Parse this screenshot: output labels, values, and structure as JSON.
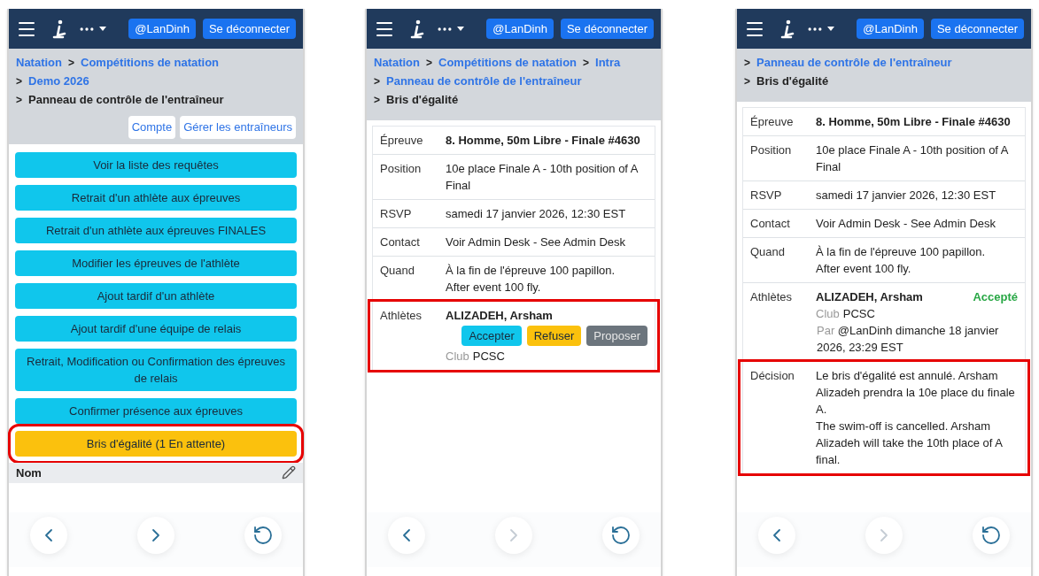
{
  "screens": [
    {
      "header": {
        "user": "@LanDinh",
        "logout": "Se déconnecter"
      },
      "breadcrumb": [
        [
          {
            "kind": "link",
            "text": "Natation"
          },
          {
            "kind": "separator",
            "text": ">"
          },
          {
            "kind": "link",
            "text": "Compétitions de natation"
          }
        ],
        [
          {
            "kind": "separator",
            "text": ">"
          },
          {
            "kind": "link",
            "text": "Demo 2026"
          }
        ],
        [
          {
            "kind": "separator",
            "text": ">"
          },
          {
            "kind": "current",
            "text": "Panneau de contrôle de l'entraîneur"
          }
        ]
      ],
      "account_buttons": [
        "Compte",
        "Gérer les entraîneurs"
      ],
      "actions": [
        {
          "label": "Voir la liste des requêtes",
          "kind": "primary",
          "highlighted": false
        },
        {
          "label": "Retrait d'un athlète aux épreuves",
          "kind": "primary",
          "highlighted": false
        },
        {
          "label": "Retrait d'un athlète aux épreuves FINALES",
          "kind": "primary",
          "highlighted": false
        },
        {
          "label": "Modifier les épreuves de l'athlète",
          "kind": "primary",
          "highlighted": false
        },
        {
          "label": "Ajout tardif d'un athlète",
          "kind": "primary",
          "highlighted": false
        },
        {
          "label": "Ajout tardif d'une équipe de relais",
          "kind": "primary",
          "highlighted": false
        },
        {
          "label": "Retrait, Modification ou Confirmation des épreuves de relais",
          "kind": "primary",
          "highlighted": false
        },
        {
          "label": "Confirmer présence aux épreuves",
          "kind": "primary",
          "highlighted": false
        },
        {
          "label": "Bris d'égalité (1 En attente)",
          "kind": "warning",
          "highlighted": true
        }
      ],
      "name_row": {
        "label": "Nom"
      },
      "nav": [
        {
          "kind": "back",
          "disabled": false
        },
        {
          "kind": "forward",
          "disabled": false
        },
        {
          "kind": "reload",
          "disabled": false
        }
      ]
    },
    {
      "header": {
        "user": "@LanDinh",
        "logout": "Se déconnecter"
      },
      "breadcrumb": [
        [
          {
            "kind": "link",
            "text": "Natation"
          },
          {
            "kind": "separator",
            "text": ">"
          },
          {
            "kind": "link",
            "text": "Compétitions de natation"
          },
          {
            "kind": "separator",
            "text": ">"
          },
          {
            "kind": "link",
            "text": "Intra"
          }
        ],
        [
          {
            "kind": "separator",
            "text": ">"
          },
          {
            "kind": "link",
            "text": "Panneau de contrôle de l'entraîneur"
          }
        ],
        [
          {
            "kind": "separator",
            "text": ">"
          },
          {
            "kind": "current",
            "text": "Bris d'égalité"
          }
        ]
      ],
      "details": [
        {
          "kind": "text",
          "label": "Épreuve",
          "value": "8. Homme, 50m Libre - Finale #4630",
          "bold": true,
          "highlighted": false
        },
        {
          "kind": "text",
          "label": "Position",
          "value": "10e place Finale A - 10th position of A Final",
          "bold": false,
          "highlighted": false
        },
        {
          "kind": "text",
          "label": "RSVP",
          "value": "samedi 17 janvier 2026, 12:30 EST",
          "bold": false,
          "highlighted": false
        },
        {
          "kind": "text",
          "label": "Contact",
          "value": "Voir Admin Desk - See Admin Desk",
          "bold": false,
          "highlighted": false
        },
        {
          "kind": "text",
          "label": "Quand",
          "lines": [
            "À la fin de l'épreuve 100 papillon.",
            "After event 100 fly."
          ],
          "bold": false,
          "highlighted": false
        },
        {
          "kind": "athlete",
          "label": "Athlètes",
          "name": "ALIZADEH, Arsham",
          "buttons": [
            {
              "label": "Accepter",
              "kind": "primary"
            },
            {
              "label": "Refuser",
              "kind": "warning"
            },
            {
              "label": "Proposer",
              "kind": "secondary"
            }
          ],
          "club_label": "Club",
          "club": "PCSC",
          "highlighted": true
        }
      ],
      "nav": [
        {
          "kind": "back",
          "disabled": false
        },
        {
          "kind": "forward",
          "disabled": true
        },
        {
          "kind": "reload",
          "disabled": false
        }
      ]
    },
    {
      "header": {
        "user": "@LanDinh",
        "logout": "Se déconnecter"
      },
      "breadcrumb": [
        [
          {
            "kind": "separator",
            "text": ">"
          },
          {
            "kind": "link",
            "text": "Panneau de contrôle de l'entraîneur"
          }
        ],
        [
          {
            "kind": "separator",
            "text": ">"
          },
          {
            "kind": "current",
            "text": "Bris d'égalité"
          }
        ]
      ],
      "details": [
        {
          "kind": "text",
          "label": "Épreuve",
          "value": "8. Homme, 50m Libre - Finale #4630",
          "bold": true,
          "highlighted": false
        },
        {
          "kind": "text",
          "label": "Position",
          "value": "10e place Finale A - 10th position of A Final",
          "bold": false,
          "highlighted": false
        },
        {
          "kind": "text",
          "label": "RSVP",
          "value": "samedi 17 janvier 2026, 12:30 EST",
          "bold": false,
          "highlighted": false
        },
        {
          "kind": "text",
          "label": "Contact",
          "value": "Voir Admin Desk - See Admin Desk",
          "bold": false,
          "highlighted": false
        },
        {
          "kind": "text",
          "label": "Quand",
          "lines": [
            "À la fin de l'épreuve 100 papillon.",
            "After event 100 fly."
          ],
          "bold": false,
          "highlighted": false
        },
        {
          "kind": "athlete",
          "label": "Athlètes",
          "name": "ALIZADEH, Arsham",
          "status": "Accepté",
          "club_label": "Club",
          "club": "PCSC",
          "by_label": "Par",
          "by": "@LanDinh dimanche 18 janvier 2026, 23:29 EST",
          "highlighted": false
        },
        {
          "kind": "text",
          "label": "Décision",
          "lines": [
            "Le bris d'égalité est annulé. Arsham Alizadeh prendra la 10e place du finale A.",
            "The swim-off is cancelled. Arsham Alizadeh will take the 10th place of A final."
          ],
          "bold": false,
          "highlighted": true
        }
      ],
      "nav": [
        {
          "kind": "back",
          "disabled": false
        },
        {
          "kind": "forward",
          "disabled": true
        },
        {
          "kind": "reload",
          "disabled": false
        }
      ]
    }
  ]
}
